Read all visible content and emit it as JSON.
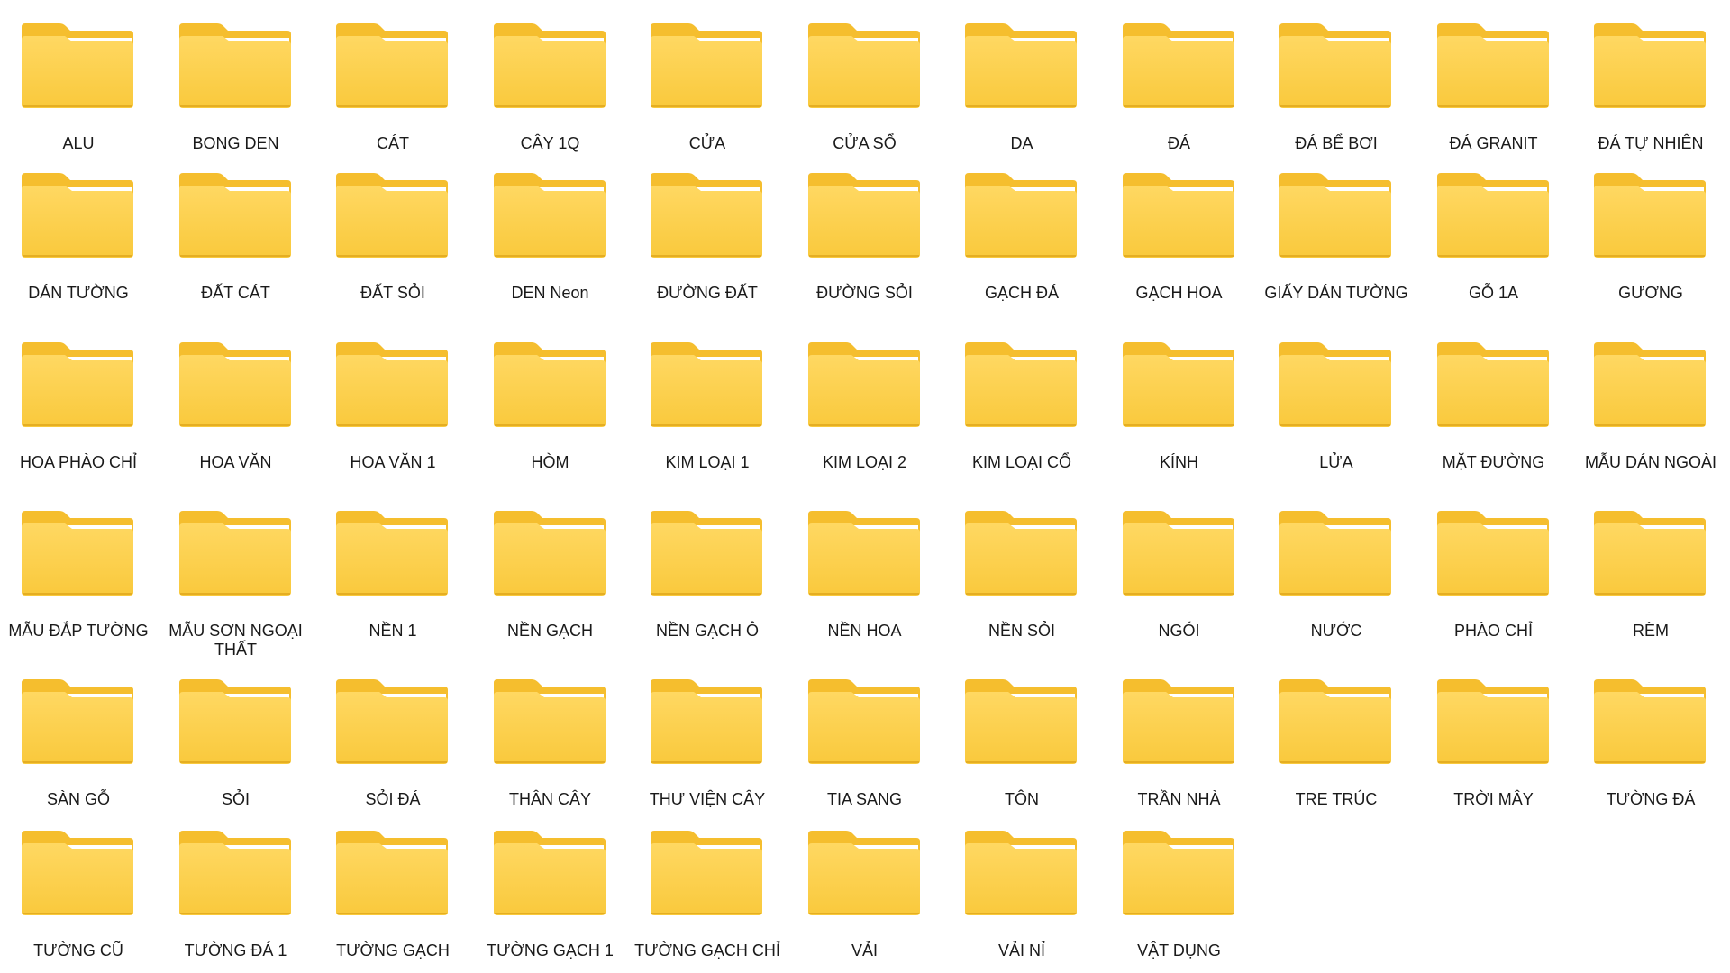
{
  "folders": [
    "ALU",
    "BONG DEN",
    "CÁT",
    "CÂY 1Q",
    "CỬA",
    "CỬA SỔ",
    "DA",
    "ĐÁ",
    "ĐÁ BỂ BƠI",
    "ĐÁ GRANIT",
    "ĐÁ TỰ NHIÊN",
    "DÁN TƯỜNG",
    "ĐẤT CÁT",
    "ĐẤT SỎI",
    "DEN Neon",
    "ĐƯỜNG ĐẤT",
    "ĐƯỜNG SỎI",
    "GẠCH ĐÁ",
    "GẠCH HOA",
    "GIẤY DÁN TƯỜNG",
    "GỖ 1A",
    "GƯƠNG",
    "HOA PHÀO CHỈ",
    "HOA VĂN",
    "HOA VĂN 1",
    "HÒM",
    "KIM LOẠI 1",
    "KIM LOẠI 2",
    "KIM LOẠI CỔ",
    "KÍNH",
    "LỬA",
    "MẶT ĐƯỜNG",
    "MẪU DÁN NGOÀI",
    "MẪU ĐẮP TƯỜNG",
    "MẪU SƠN NGOẠI THẤT",
    "NỀN 1",
    "NỀN GẠCH",
    "NỀN GẠCH Ô",
    "NỀN HOA",
    "NỀN SỎI",
    "NGÓI",
    "NƯỚC",
    "PHÀO CHỈ",
    "RÈM",
    "SÀN GỖ",
    "SỎI",
    "SỎI ĐÁ",
    "THÂN CÂY",
    "THƯ VIỆN CÂY",
    "TIA SANG",
    "TÔN",
    "TRẦN NHÀ",
    "TRE TRÚC",
    "TRỜI MÂY",
    "TƯỜNG  ĐÁ",
    "TƯỜNG CŨ",
    "TƯỜNG ĐÁ 1",
    "TƯỜNG GẠCH",
    "TƯỜNG GẠCH 1",
    "TƯỜNG GẠCH CHỈ",
    "VẢI",
    "VẢI NỈ",
    "VẬT DỤNG"
  ],
  "colors": {
    "folder_back": "#F5BE2E",
    "folder_front": "#FFD862",
    "folder_front_bottom": "#F9C93C",
    "paper": "#FFFFFF",
    "label_text": "#1A1A1A"
  },
  "icon": "folder-icon"
}
